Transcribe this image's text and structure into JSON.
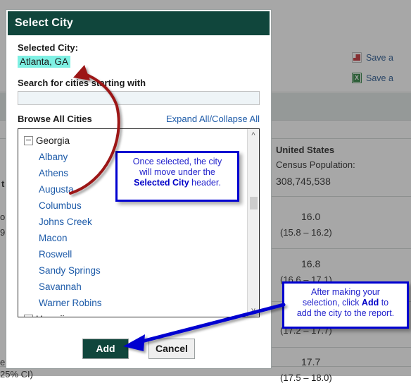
{
  "dialog": {
    "title": "Select City",
    "selected_city_label": "Selected City:",
    "selected_city_value": "Atlanta, GA",
    "search_label": "Search for cities starting with",
    "search_value": "",
    "search_placeholder": "",
    "browse_label": "Browse All Cities",
    "expand_collapse_label": "Expand All/Collapse All",
    "add_label": "Add",
    "cancel_label": "Cancel",
    "tree": [
      {
        "type": "group",
        "label": "Georgia"
      },
      {
        "type": "city",
        "label": "Albany"
      },
      {
        "type": "city",
        "label": "Athens"
      },
      {
        "type": "city",
        "label": "Augusta"
      },
      {
        "type": "city",
        "label": "Columbus"
      },
      {
        "type": "city",
        "label": "Johns Creek"
      },
      {
        "type": "city",
        "label": "Macon"
      },
      {
        "type": "city",
        "label": "Roswell"
      },
      {
        "type": "city",
        "label": "Sandy Springs"
      },
      {
        "type": "city",
        "label": "Savannah"
      },
      {
        "type": "city",
        "label": "Warner Robins"
      },
      {
        "type": "group",
        "label": "Hawaii"
      }
    ],
    "scrollbar": {
      "up_icon": "chevron-up-icon",
      "down_icon": "chevron-down-icon"
    }
  },
  "callouts": {
    "selected": {
      "line1": "Once selected, the city",
      "line2": "will move under the",
      "bold": "Selected City",
      "line3_tail": " header."
    },
    "add": {
      "line1": "After making your",
      "line2_pre": "selection, click ",
      "bold": "Add",
      "line2_post": " to",
      "line3": "add the city to the report."
    }
  },
  "background": {
    "save_pdf_label": "Save a",
    "save_excel_label": "Save a",
    "save_pdf_icon": "pdf-file-icon",
    "save_excel_icon": "excel-file-icon",
    "country_title": "United States",
    "census_label": "Census Population:",
    "census_value": "308,745,538",
    "stats": [
      {
        "value": "16.0",
        "ci": "(15.8 – 16.2)"
      },
      {
        "value": "16.8",
        "ci": "(16.6 – 17.1)"
      },
      {
        "value": "",
        "ci": "(17.2 – 17.7)"
      },
      {
        "value": "17.7",
        "ci": "(17.5 – 18.0)"
      }
    ]
  },
  "colors": {
    "brand_green": "#10463c",
    "link_blue": "#1c5aa8",
    "highlight_cyan": "#7ef0e3",
    "callout_blue": "#0000d0",
    "arrow_red": "#9c1519"
  }
}
